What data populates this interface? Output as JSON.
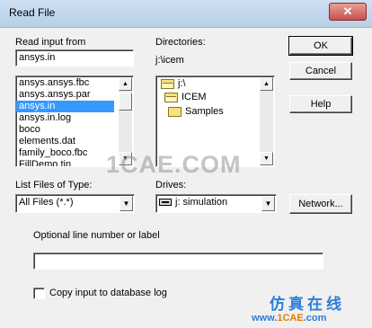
{
  "window": {
    "title": "Read File",
    "close_glyph": "✕"
  },
  "read_input": {
    "label": "Read input from",
    "value": "ansys.in",
    "files": [
      "ansys.ansys.fbc",
      "ansys.ansys.par",
      "ansys.in",
      "ansys.in.log",
      "boco",
      "elements.dat",
      "family_boco.fbc",
      "FillDemo.tin"
    ],
    "selected_index": 2
  },
  "directories": {
    "label": "Directories:",
    "path": "j:\\icem",
    "items": [
      {
        "name": "j:\\",
        "icon": "open-folder-icon"
      },
      {
        "name": "ICEM",
        "icon": "open-folder-icon"
      },
      {
        "name": "Samples",
        "icon": "folder-icon"
      }
    ]
  },
  "buttons": {
    "ok": "OK",
    "cancel": "Cancel",
    "help": "Help",
    "network": "Network..."
  },
  "file_types": {
    "label": "List Files of Type:",
    "value": "All Files (*.*)"
  },
  "drives": {
    "label": "Drives:",
    "value": "j: simulation"
  },
  "optional": {
    "label": "Optional line number or label",
    "value": ""
  },
  "copy_input": {
    "label": "Copy input to database log",
    "checked": false
  },
  "watermark": {
    "main": "1CAE.COM",
    "cn": "仿真在线",
    "url_prefix": "www.",
    "url_brand": "1CAE",
    "url_suffix": ".com"
  }
}
